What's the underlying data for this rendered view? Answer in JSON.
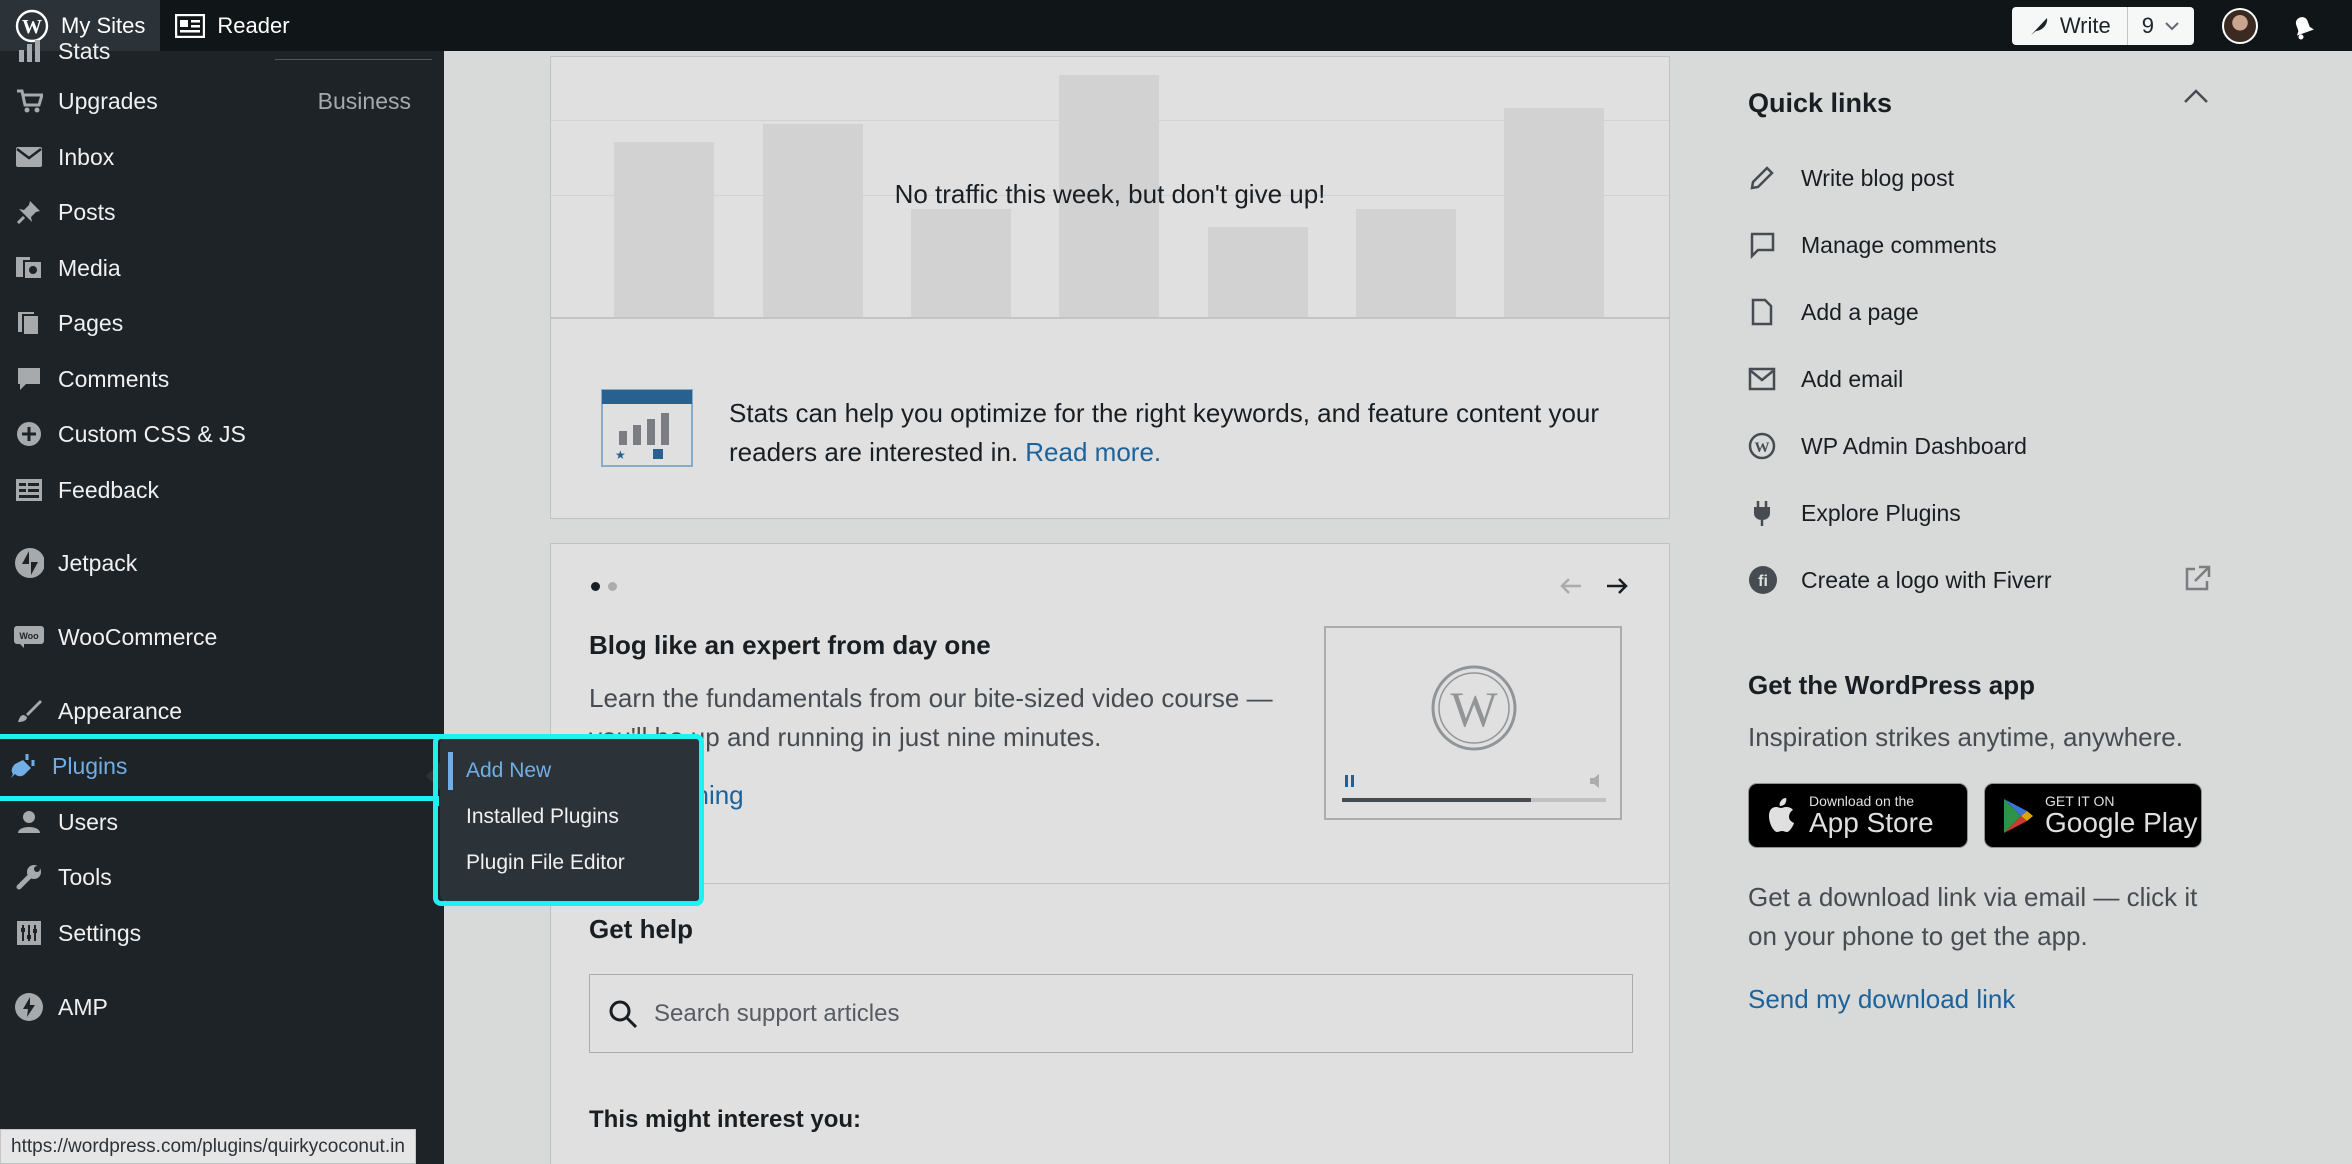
{
  "topbar": {
    "my_sites": "My Sites",
    "reader": "Reader",
    "write": "Write",
    "draft_count": "9"
  },
  "sidebar": {
    "items": [
      {
        "label": "Stats",
        "icon": "stats-icon"
      },
      {
        "label": "Upgrades",
        "icon": "cart-icon",
        "badge": "Business"
      },
      {
        "label": "Inbox",
        "icon": "mail-icon"
      },
      {
        "label": "Posts",
        "icon": "pin-icon"
      },
      {
        "label": "Media",
        "icon": "media-icon"
      },
      {
        "label": "Pages",
        "icon": "pages-icon"
      },
      {
        "label": "Comments",
        "icon": "comment-icon"
      },
      {
        "label": "Custom CSS & JS",
        "icon": "plus-circle-icon"
      },
      {
        "label": "Feedback",
        "icon": "feedback-icon"
      },
      {
        "label": "Jetpack",
        "icon": "jetpack-icon"
      },
      {
        "label": "WooCommerce",
        "icon": "woo-icon"
      },
      {
        "label": "Appearance",
        "icon": "brush-icon"
      },
      {
        "label": "Plugins",
        "icon": "plug-icon"
      },
      {
        "label": "Users",
        "icon": "user-icon"
      },
      {
        "label": "Tools",
        "icon": "wrench-icon"
      },
      {
        "label": "Settings",
        "icon": "settings-icon"
      },
      {
        "label": "AMP",
        "icon": "amp-icon"
      }
    ],
    "plugins_flyout": [
      "Add New",
      "Installed Plugins",
      "Plugin File Editor"
    ]
  },
  "status_url": "https://wordpress.com/plugins/quirkycoconut.in",
  "stats_card": {
    "empty_message": "No traffic this week, but don't give up!",
    "tip": "Stats can help you optimize for the right keywords, and feature content your readers are interested in.",
    "read_more": "Read more."
  },
  "course_card": {
    "title": "Blog like an expert from day one",
    "desc": "Learn the fundamentals from our bite-sized video course — you'll be up and running in just nine minutes.",
    "link": "Start learning"
  },
  "help_card": {
    "title": "Get help",
    "search_placeholder": "Search support articles",
    "interest": "This might interest you:"
  },
  "quick_links": {
    "title": "Quick links",
    "items": [
      {
        "label": "Write blog post",
        "icon": "pencil-icon"
      },
      {
        "label": "Manage comments",
        "icon": "comment-icon"
      },
      {
        "label": "Add a page",
        "icon": "page-icon"
      },
      {
        "label": "Add email",
        "icon": "mail-icon"
      },
      {
        "label": "WP Admin Dashboard",
        "icon": "wordpress-icon"
      },
      {
        "label": "Explore Plugins",
        "icon": "plug-icon"
      },
      {
        "label": "Create a logo with Fiverr",
        "icon": "fiverr-icon"
      }
    ]
  },
  "app_promo": {
    "title": "Get the WordPress app",
    "subtitle": "Inspiration strikes anytime, anywhere.",
    "app_store_small": "Download on the",
    "app_store_big": "App Store",
    "google_small": "GET IT ON",
    "google_big": "Google Play",
    "download_text": "Get a download link via email — click it on your phone to get the app.",
    "download_link": "Send my download link"
  },
  "colors": {
    "accent": "#2271b1",
    "highlight": "#1ff1f1",
    "sidebar_bg": "#1d2327",
    "active": "#72aee6"
  }
}
